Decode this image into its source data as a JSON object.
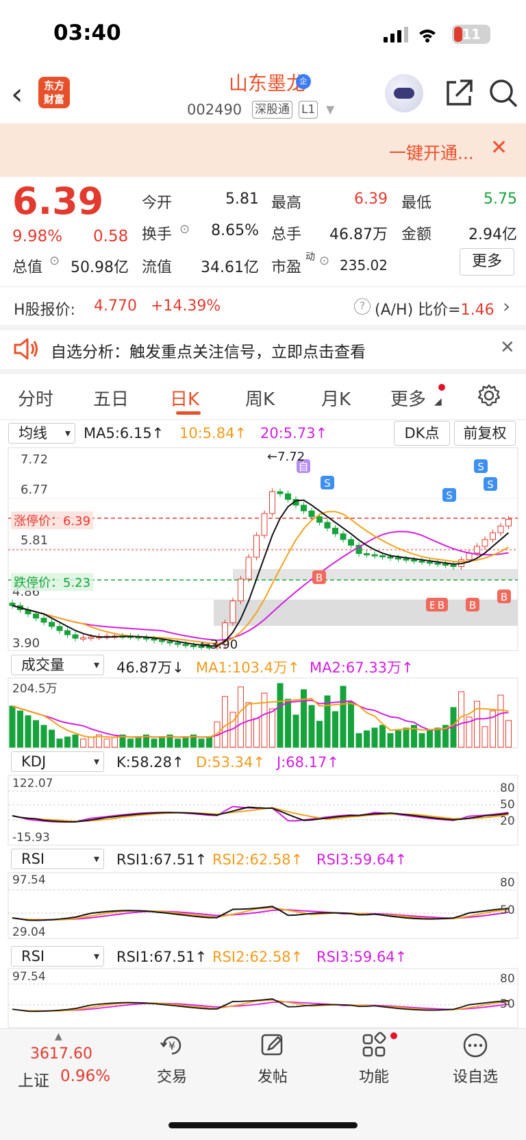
{
  "status": {
    "time": "03:40",
    "battery": "11"
  },
  "header": {
    "logo": [
      "东方",
      "财富"
    ],
    "name": "山东墨龙",
    "badge": "企",
    "code": "002490",
    "tags": [
      "深股通",
      "L1"
    ]
  },
  "banner": {
    "text": "一键开通..."
  },
  "quote": {
    "price": "6.39",
    "pct": "9.98%",
    "change": "0.58",
    "open_label": "今开",
    "open": "5.81",
    "high_label": "最高",
    "high": "6.39",
    "low_label": "最低",
    "low": "5.75",
    "turnover_label": "换手",
    "turnover": "8.65%",
    "volume_label": "总手",
    "volume": "46.87万",
    "amount_label": "金额",
    "amount": "2.94亿",
    "mktcap_label": "总值",
    "mktcap": "50.98亿",
    "float_label": "流值",
    "float": "34.61亿",
    "pe_label": "市盈",
    "pe_sup": "动",
    "pe": "235.02",
    "more": "更多"
  },
  "hshare": {
    "label": "H股报价:",
    "price": "4.770",
    "pct": "+14.39%",
    "ratio_label": "(A/H) 比价=",
    "ratio": "1.46"
  },
  "alert": {
    "text": "自选分析：触发重点关注信号，立即点击查看"
  },
  "tabs": [
    "分时",
    "五日",
    "日K",
    "周K",
    "月K",
    "更多"
  ],
  "active_tab": "日K",
  "ma_bar": {
    "selector": "均线",
    "ma5": "MA5:6.15↑",
    "ma10": "10:5.84↑",
    "ma20": "20:5.73↑",
    "dk": "DK点",
    "adj": "前复权"
  },
  "kline": {
    "max_label": "7.72",
    "mid1": "6.77",
    "mid2": "5.81",
    "mid3": "4.86",
    "min_label": "3.90",
    "peak_label": "←7.72",
    "low_label": "←3.90",
    "limit_up": "涨停价：6.39",
    "limit_down": "跌停价：5.23",
    "signal_s": "S",
    "signal_b": "B",
    "mark_zi": "自",
    "colors": {
      "up": "#e23a2e",
      "down": "#16a33c",
      "ma5": "#111111",
      "ma10": "#f2a31b",
      "ma20": "#d21ee0"
    }
  },
  "vol_bar": {
    "selector": "成交量",
    "vol": "46.87万↓",
    "ma1": "MA1:103.4万↑",
    "ma2": "MA2:67.33万↑",
    "max_label": "204.5万"
  },
  "kdj_bar": {
    "selector": "KDJ",
    "k": "K:58.28↑",
    "d": "D:53.34↑",
    "j": "J:68.17↑",
    "max": "122.07",
    "min": "-15.93",
    "l80": "80",
    "l50": "50",
    "l20": "20"
  },
  "rsi_bar": {
    "selector": "RSI",
    "r1": "RSI1:67.51↑",
    "r2": "RSI2:62.58↑",
    "r3": "RSI3:59.64↑",
    "max": "97.54",
    "min": "29.04",
    "l80": "80",
    "l50": "50"
  },
  "bottom": {
    "index_value": "3617.60",
    "index_name": "上证",
    "index_pct": "0.96%",
    "nav": [
      "交易",
      "发帖",
      "功能",
      "设自选"
    ]
  }
}
